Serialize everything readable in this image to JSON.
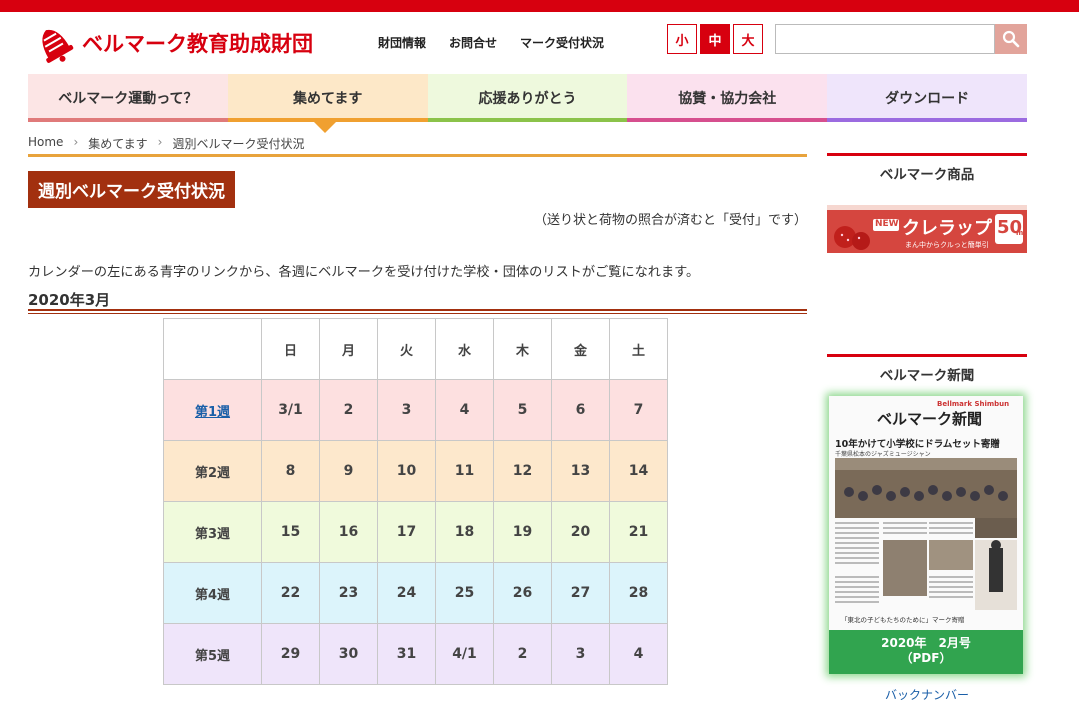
{
  "header": {
    "logo_text": "ベルマーク教育助成財団",
    "links": [
      "財団情報",
      "お問合せ",
      "マーク受付状況"
    ],
    "font_sizes": [
      "小",
      "中",
      "大"
    ],
    "active_font_size": "中",
    "search_placeholder": ""
  },
  "nav": {
    "items": [
      {
        "label": "ベルマーク運動って？",
        "bg": "#fce5e5",
        "bar": "#e07a7a"
      },
      {
        "label": "集めてます",
        "bg": "#fde8c8",
        "bar": "#f0a030"
      },
      {
        "label": "応援ありがとう",
        "bg": "#eef9dd",
        "bar": "#8bc34a"
      },
      {
        "label": "協賛・協力会社",
        "bg": "#fbe1ee",
        "bar": "#d64f8e"
      },
      {
        "label": "ダウンロード",
        "bg": "#efe5fb",
        "bar": "#9b6be0"
      }
    ]
  },
  "breadcrumb": [
    "Home",
    "集めてます",
    "週別ベルマーク受付状況"
  ],
  "main": {
    "title": "週別ベルマーク受付状況",
    "note": "（送り状と荷物の照合が済むと「受付」です）",
    "description": "カレンダーの左にある青字のリンクから、各週にベルマークを受け付けた学校・団体のリストがご覧になれます。",
    "month": "2020年3月"
  },
  "calendar": {
    "weekdays": [
      "日",
      "月",
      "火",
      "水",
      "木",
      "金",
      "土"
    ],
    "weeks": [
      {
        "label": "第1週",
        "linked": true,
        "bg": "#fde0e0",
        "days": [
          "3/1",
          "2",
          "3",
          "4",
          "5",
          "6",
          "7"
        ]
      },
      {
        "label": "第2週",
        "linked": false,
        "bg": "#fde8cc",
        "days": [
          "8",
          "9",
          "10",
          "11",
          "12",
          "13",
          "14"
        ]
      },
      {
        "label": "第3週",
        "linked": false,
        "bg": "#f0fadc",
        "days": [
          "15",
          "16",
          "17",
          "18",
          "19",
          "20",
          "21"
        ]
      },
      {
        "label": "第4週",
        "linked": false,
        "bg": "#dcf4fb",
        "days": [
          "22",
          "23",
          "24",
          "25",
          "26",
          "27",
          "28"
        ]
      },
      {
        "label": "第5週",
        "linked": false,
        "bg": "#efe5fa",
        "days": [
          "29",
          "30",
          "31",
          "4/1",
          "2",
          "3",
          "4"
        ]
      }
    ]
  },
  "sidebar": {
    "products_heading": "ベルマーク商品",
    "product_new": "NEW",
    "product_name": "クレラップ",
    "product_size": "50",
    "product_unit": "m",
    "product_tagline": "まん中からクルっと簡単引",
    "news_heading": "ベルマーク新聞",
    "news_masthead_en": "Bellmark Shimbun",
    "news_masthead": "ベルマーク新聞",
    "news_headline": "10年かけて小学校にドラムセット寄贈",
    "news_sub": "千葉県松本のジャズミュージシャン",
    "news_footer": "「東北の子どもたちのために」マーク寄贈",
    "news_issue_line1": "2020年　2月号",
    "news_issue_line2": "（PDF）",
    "back_numbers": "バックナンバー"
  }
}
